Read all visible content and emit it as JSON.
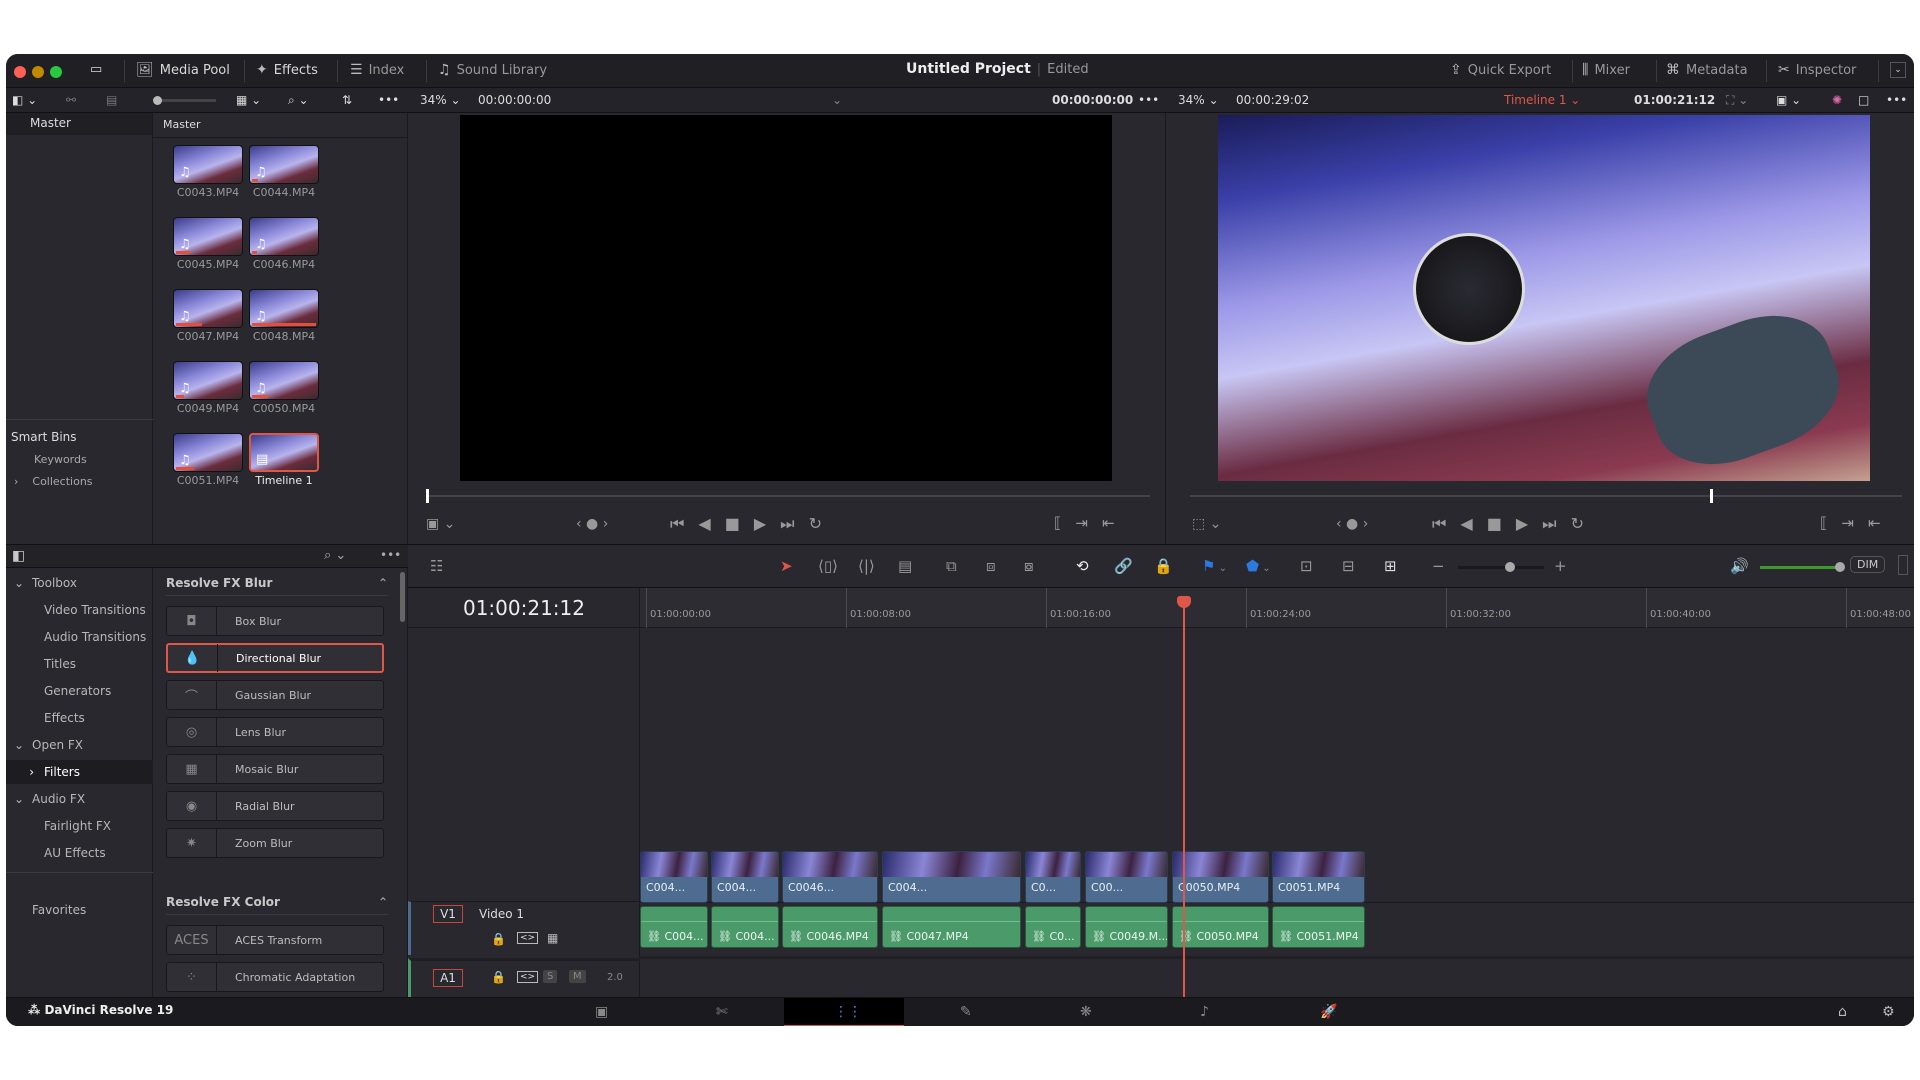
{
  "app": {
    "name": "DaVinci Resolve 19",
    "project_title": "Untitled Project",
    "project_status": "Edited"
  },
  "header": {
    "left_buttons": [
      {
        "label": "Media Pool",
        "icon": "media-pool-icon"
      },
      {
        "label": "Effects",
        "icon": "effects-wand-icon"
      },
      {
        "label": "Index",
        "icon": "list-icon"
      },
      {
        "label": "Sound Library",
        "icon": "sound-library-icon"
      }
    ],
    "right_buttons": [
      {
        "label": "Quick Export",
        "icon": "export-icon"
      },
      {
        "label": "Mixer",
        "icon": "mixer-icon"
      },
      {
        "label": "Metadata",
        "icon": "metadata-icon"
      },
      {
        "label": "Inspector",
        "icon": "inspector-icon"
      }
    ]
  },
  "source_viewer": {
    "zoom": "34%",
    "timecode_in": "00:00:00:00",
    "timecode_out": "00:00:00:00",
    "playhead": 0.0
  },
  "timeline_viewer": {
    "zoom": "34%",
    "duration": "00:00:29:02",
    "timeline_name": "Timeline 1",
    "timecode": "01:00:21:12",
    "playhead": 0.73
  },
  "bins": {
    "master": "Master",
    "smart_bins": "Smart Bins",
    "smart_items": [
      "Keywords",
      "Collections"
    ]
  },
  "media_pool": {
    "title": "Master",
    "clips": [
      {
        "name": "C0043.MP4",
        "usage": 0
      },
      {
        "name": "C0044.MP4",
        "usage": 0.1
      },
      {
        "name": "C0045.MP4",
        "usage": 0.22
      },
      {
        "name": "C0046.MP4",
        "usage": 0.08
      },
      {
        "name": "C0047.MP4",
        "usage": 0.4
      },
      {
        "name": "C0048.MP4",
        "usage": 1.0
      },
      {
        "name": "C0049.MP4",
        "usage": 0.12
      },
      {
        "name": "C0050.MP4",
        "usage": 0.25
      },
      {
        "name": "C0051.MP4",
        "usage": 0.28
      },
      {
        "name": "Timeline 1",
        "usage": 0,
        "selected": true
      }
    ]
  },
  "effects_tree": [
    {
      "label": "Toolbox",
      "level": 0,
      "expanded": true
    },
    {
      "label": "Video Transitions",
      "level": 1
    },
    {
      "label": "Audio Transitions",
      "level": 1
    },
    {
      "label": "Titles",
      "level": 1
    },
    {
      "label": "Generators",
      "level": 1
    },
    {
      "label": "Effects",
      "level": 1
    },
    {
      "label": "Open FX",
      "level": 0,
      "expanded": true
    },
    {
      "label": "Filters",
      "level": 1,
      "selected": true
    },
    {
      "label": "Audio FX",
      "level": 0,
      "expanded": true
    },
    {
      "label": "Fairlight FX",
      "level": 1
    },
    {
      "label": "AU Effects",
      "level": 1
    },
    {
      "label": "Favorites",
      "level": 0
    }
  ],
  "effects_sections": [
    {
      "title": "Resolve FX Blur",
      "items": [
        {
          "label": "Box Blur",
          "icon": "◘"
        },
        {
          "label": "Directional Blur",
          "icon": "💧",
          "selected": true
        },
        {
          "label": "Gaussian Blur",
          "icon": "⌒"
        },
        {
          "label": "Lens Blur",
          "icon": "◎"
        },
        {
          "label": "Mosaic Blur",
          "icon": "▦"
        },
        {
          "label": "Radial Blur",
          "icon": "◉"
        },
        {
          "label": "Zoom Blur",
          "icon": "✷"
        }
      ]
    },
    {
      "title": "Resolve FX Color",
      "items": [
        {
          "label": "ACES Transform",
          "icon": "ACES"
        },
        {
          "label": "Chromatic Adaptation",
          "icon": "⁘"
        }
      ]
    }
  ],
  "timeline": {
    "timecode": "01:00:21:12",
    "ruler": [
      "01:00:00:00",
      "01:00:08:00",
      "01:00:16:00",
      "01:00:24:00",
      "01:00:32:00",
      "01:00:40:00",
      "01:00:48:00"
    ],
    "playhead_seconds": 21.5,
    "video_track": {
      "id": "V1",
      "name": "Video 1",
      "clips": [
        "C004...",
        "C004...",
        "C0046...",
        "C004...",
        "C0...",
        "C00...",
        "C0050.MP4",
        "C0051.MP4"
      ]
    },
    "audio_track": {
      "id": "A1",
      "channels": "2.0",
      "solo": "S",
      "mute": "M",
      "clips": [
        "C004...",
        "C004...",
        "C0046.MP4",
        "C0047.MP4",
        "C0...",
        "C0049.M...",
        "C0050.MP4",
        "C0051.MP4"
      ]
    },
    "audio_level": 1.0,
    "zoom_level": 0.6,
    "dim_label": "DIM"
  },
  "colors": {
    "accent": "#e0574a",
    "video_clip": "#4d6c8f",
    "audio_clip": "#4a9a6a",
    "timeline_name": "#e0574a",
    "volume": "#3c9a2c"
  }
}
